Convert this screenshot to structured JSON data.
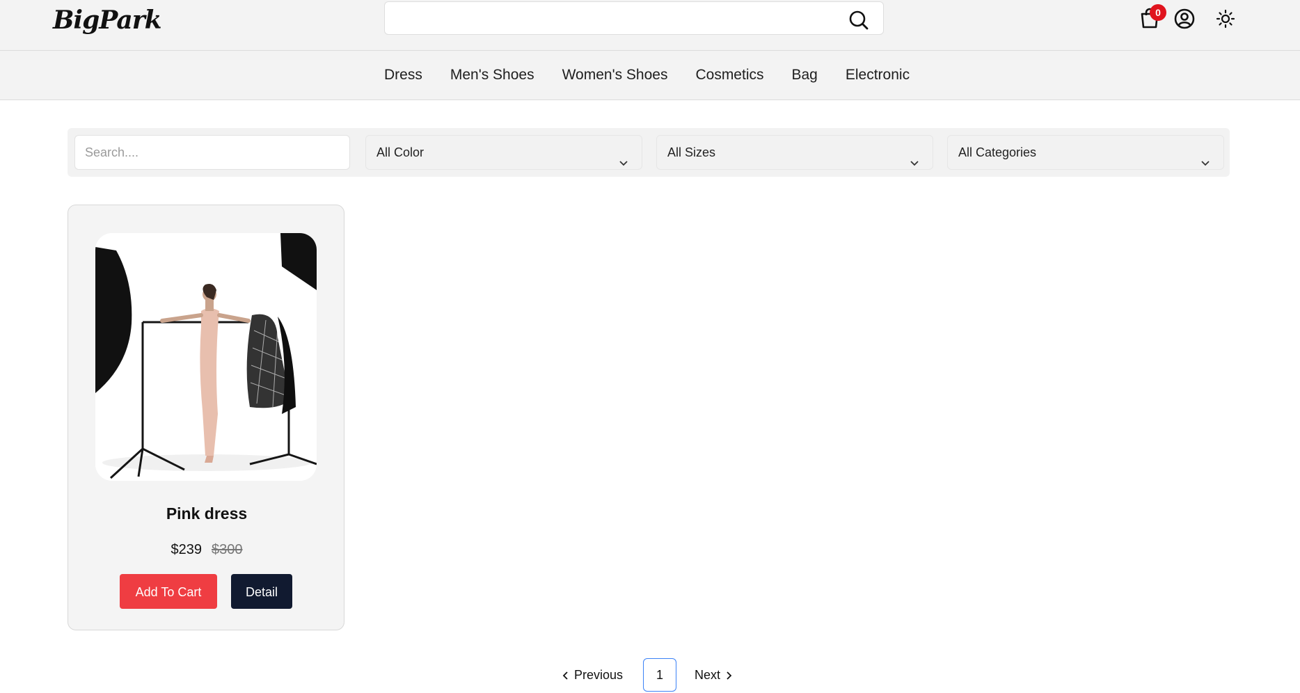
{
  "header": {
    "logo_text": "BigPark",
    "search_value": "",
    "cart_count": "0"
  },
  "nav": {
    "items": [
      "Dress",
      "Men's Shoes",
      "Women's Shoes",
      "Cosmetics",
      "Bag",
      "Electronic"
    ]
  },
  "filters": {
    "search_placeholder": "Search....",
    "color": "All Color",
    "size": "All Sizes",
    "category": "All Categories"
  },
  "product": {
    "name": "Pink dress",
    "price": "$239",
    "old_price": "$300",
    "add_to_cart_label": "Add To Cart",
    "detail_label": "Detail"
  },
  "pagination": {
    "previous_label": "Previous",
    "current_page": "1",
    "next_label": "Next"
  },
  "colors": {
    "accent_red": "#ef3d42",
    "dark_button": "#111a30",
    "badge_red": "#e0141e",
    "page_border_blue": "#3b82f6"
  },
  "icons": [
    "search-icon",
    "cart-icon",
    "account-icon",
    "sun-icon",
    "chevron-down-icon",
    "chevron-left-icon",
    "chevron-right-icon"
  ]
}
